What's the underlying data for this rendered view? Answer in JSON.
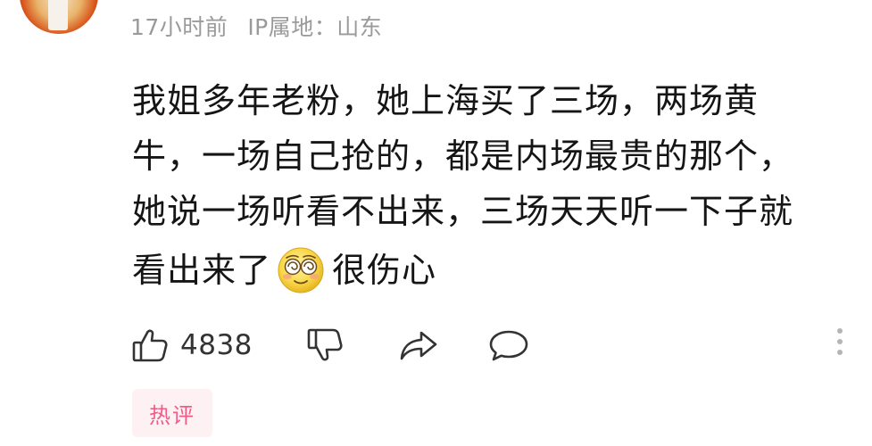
{
  "meta": {
    "time": "17小时前",
    "ip_label": "IP属地：山东"
  },
  "comment": {
    "lines": [
      "我姐多年老粉，她上海买了三场，两场黄",
      "牛，一场自己抢的，都是内场最贵的那个，",
      "她说一场听看不出来，三场天天听一下子就"
    ],
    "last_line_before_emoji": "看出来了",
    "last_line_after_emoji": "很伤心",
    "emoji": "dizzy-eyes-emoji"
  },
  "actions": {
    "like_count": "4838",
    "icons": [
      "thumbs-up-icon",
      "thumbs-down-icon",
      "share-icon",
      "comment-icon",
      "more-vertical-icon"
    ]
  },
  "tag": {
    "label": "热评"
  },
  "colors": {
    "meta_text": "#9a9a9a",
    "body_text": "#151515",
    "tag_text": "#f05c86",
    "tag_bg": "#fdf1f4",
    "icon_stroke": "#333333"
  }
}
